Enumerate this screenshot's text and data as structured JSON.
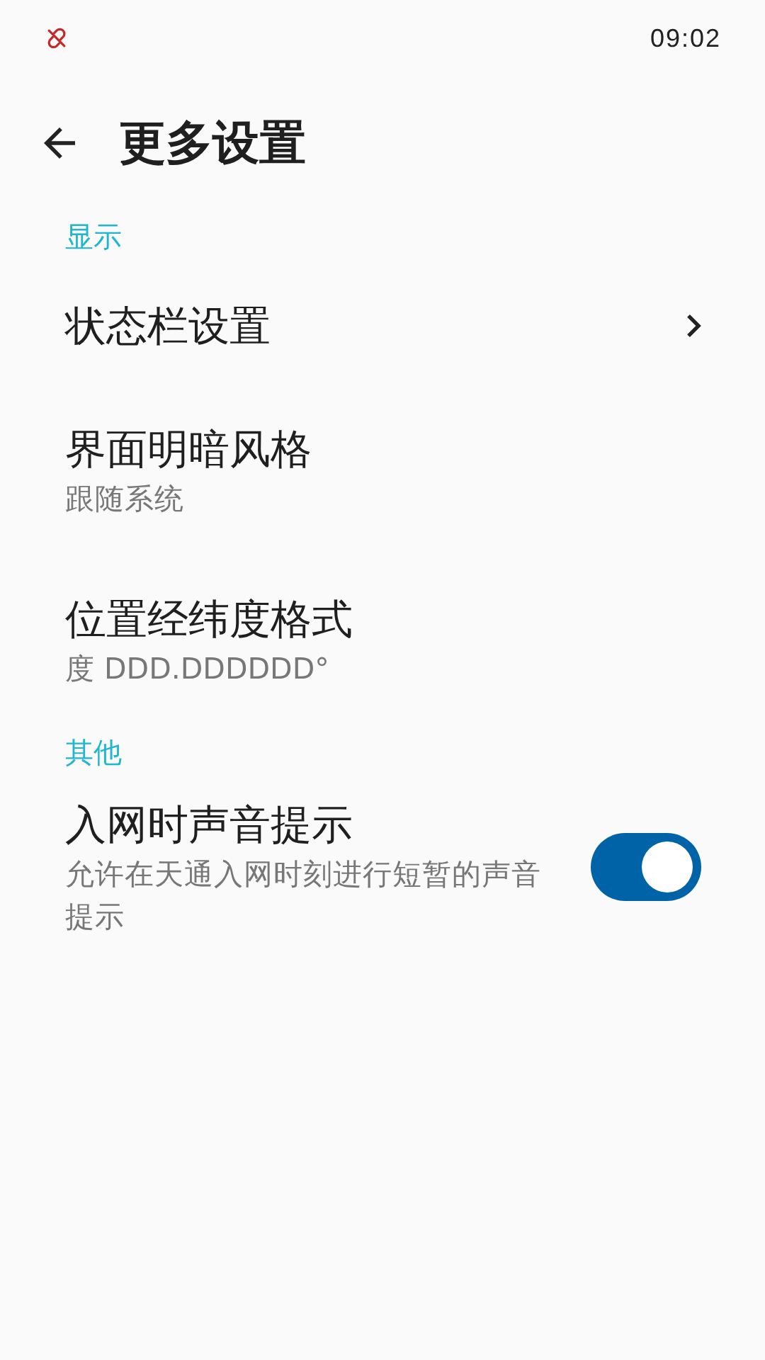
{
  "status_bar": {
    "time": "09:02"
  },
  "title": "更多设置",
  "sections": [
    {
      "header": "显示",
      "items": [
        {
          "kind": "link",
          "title": "状态栏设置"
        },
        {
          "kind": "value",
          "title": "界面明暗风格",
          "summary": "跟随系统"
        },
        {
          "kind": "value",
          "title": "位置经纬度格式",
          "summary": "度 DDD.DDDDDD°"
        }
      ]
    },
    {
      "header": "其他",
      "items": [
        {
          "kind": "switch",
          "title": "入网时声音提示",
          "summary": "允许在天通入网时刻进行短暂的声音提示",
          "on": true
        }
      ]
    }
  ]
}
